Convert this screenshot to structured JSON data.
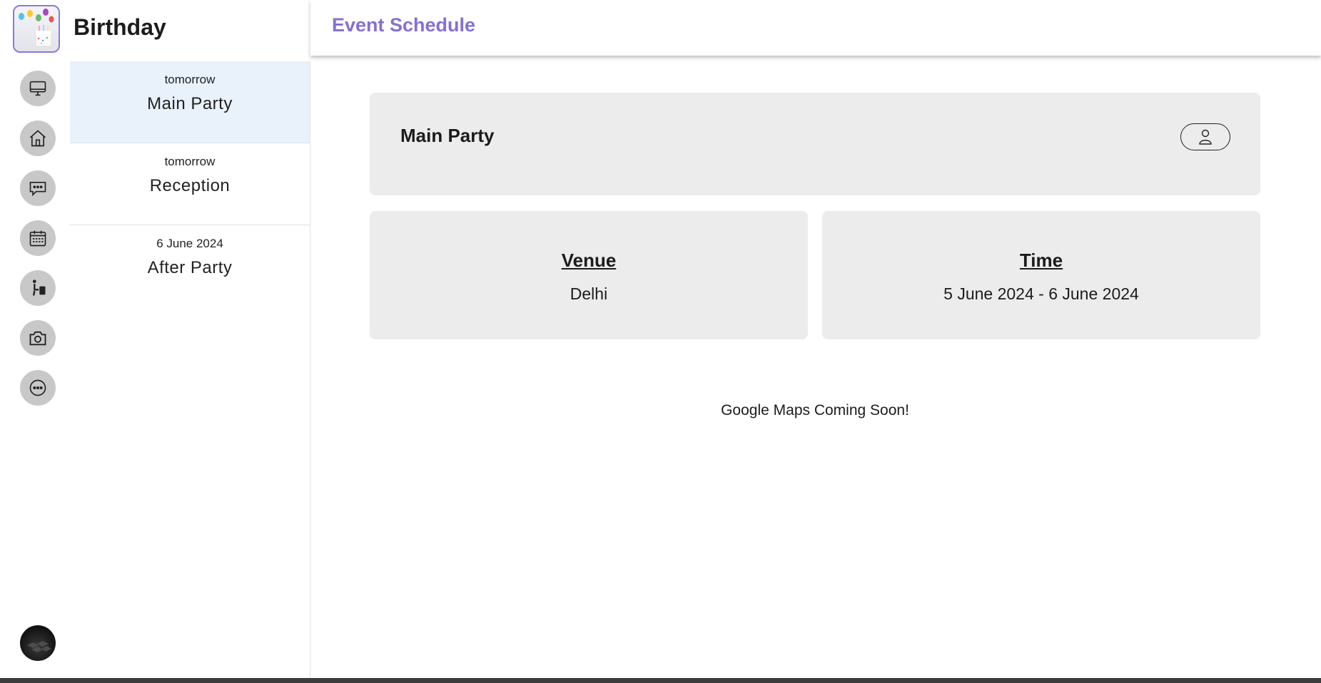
{
  "app": {
    "title": "Birthday"
  },
  "header": {
    "title": "Event Schedule"
  },
  "rail": {
    "items": [
      {
        "name": "monitor-icon"
      },
      {
        "name": "home-icon"
      },
      {
        "name": "chat-icon"
      },
      {
        "name": "calendar-icon"
      },
      {
        "name": "accessibility-icon"
      },
      {
        "name": "camera-icon"
      },
      {
        "name": "more-icon"
      }
    ]
  },
  "events": [
    {
      "when": "tomorrow",
      "name": "Main Party",
      "active": true
    },
    {
      "when": "tomorrow",
      "name": "Reception",
      "active": false
    },
    {
      "when": "6 June 2024",
      "name": "After Party",
      "active": false
    }
  ],
  "detail": {
    "title": "Main Party",
    "venue_heading": "Venue",
    "venue_value": "Delhi",
    "time_heading": "Time",
    "time_value": "5 June 2024 - 6 June 2024",
    "maps_note": "Google Maps Coming Soon!"
  },
  "colors": {
    "accent": "#8470d4",
    "active_item": "#e9f1fb",
    "card": "#ececec",
    "rail_button": "#c8c8c8"
  }
}
